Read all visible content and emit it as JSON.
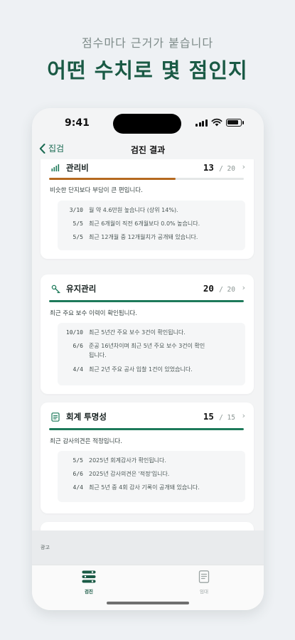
{
  "hero": {
    "subtitle": "점수마다 근거가 붙습니다",
    "title": "어떤 수치로 몇 점인지"
  },
  "status_bar": {
    "time": "9:41"
  },
  "nav": {
    "back_label": "집검",
    "title": "검진 결과"
  },
  "cards": [
    {
      "icon": "bar-chart-icon",
      "title": "관리비",
      "score": "13",
      "max": "/ 20",
      "progress": 0.65,
      "bar_color": "#b5691f",
      "description": "비슷한 단지보다 부담이 큰 편입니다.",
      "details": [
        {
          "points": "3/10",
          "text": "월 약 4.6만원 높습니다 (상위 14%)."
        },
        {
          "points": "5/5",
          "text": "최근 6개월이 직전 6개월보다 0.0% 높습니다."
        },
        {
          "points": "5/5",
          "text": "최근 12개월 중 12개월치가 공개돼 있습니다."
        }
      ]
    },
    {
      "icon": "wrench-icon",
      "title": "유지관리",
      "score": "20",
      "max": "/ 20",
      "progress": 1.0,
      "bar_color": "#1d7a5a",
      "description": "최근 주요 보수 이력이 확인됩니다.",
      "details": [
        {
          "points": "10/10",
          "text": "최근 5년간 주요 보수 3건이 확인됩니다."
        },
        {
          "points": "6/6",
          "text": "준공 16년차이며 최근 5년 주요 보수 3건이 확인됩니다."
        },
        {
          "points": "4/4",
          "text": "최근 2년 주요 공사 입찰 1건이 있었습니다."
        }
      ]
    },
    {
      "icon": "document-icon",
      "title": "회계 투명성",
      "score": "15",
      "max": "/ 15",
      "progress": 1.0,
      "bar_color": "#1d7a5a",
      "description": "최근 감사의견은 적정입니다.",
      "details": [
        {
          "points": "5/5",
          "text": "2025년 회계감사가 확인됩니다."
        },
        {
          "points": "6/6",
          "text": "2025년 감사의견은 '적정'입니다."
        },
        {
          "points": "4/4",
          "text": "최근 5년 중 4회 감사 기록이 공개돼 있습니다."
        }
      ]
    }
  ],
  "ad": {
    "label": "광고"
  },
  "tabs": [
    {
      "label": "검진",
      "icon": "checkup-icon",
      "active": true
    },
    {
      "label": "임대",
      "icon": "lease-doc-icon",
      "active": false
    }
  ],
  "colors": {
    "accent": "#1d7a5a",
    "warning": "#b5691f",
    "title": "#1a5a45"
  }
}
